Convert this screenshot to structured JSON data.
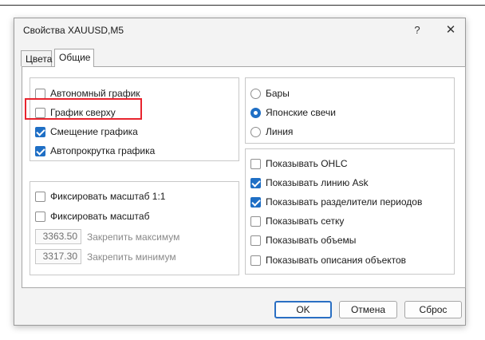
{
  "window": {
    "title": "Свойства XAUUSD,M5",
    "help_glyph": "?",
    "close_glyph": "✕"
  },
  "tabs": [
    {
      "label": "Цвета",
      "active": false
    },
    {
      "label": "Общие",
      "active": true
    }
  ],
  "left_top": [
    {
      "label": "Автономный график",
      "checked": false
    },
    {
      "label": "График сверху",
      "checked": false,
      "highlighted": true
    },
    {
      "label": "Смещение графика",
      "checked": true
    },
    {
      "label": "Автопрокрутка графика",
      "checked": true
    }
  ],
  "left_bottom": {
    "checks": [
      {
        "label": "Фиксировать масштаб 1:1",
        "checked": false
      },
      {
        "label": "Фиксировать масштаб",
        "checked": false
      }
    ],
    "fields": [
      {
        "value": "3363.50",
        "label": "Закрепить максимум"
      },
      {
        "value": "3317.30",
        "label": "Закрепить минимум"
      }
    ]
  },
  "chart_type": [
    {
      "label": "Бары",
      "selected": false
    },
    {
      "label": "Японские свечи",
      "selected": true
    },
    {
      "label": "Линия",
      "selected": false
    }
  ],
  "right_bottom": [
    {
      "label": "Показывать OHLC",
      "checked": false
    },
    {
      "label": "Показывать линию Ask",
      "checked": true
    },
    {
      "label": "Показывать разделители периодов",
      "checked": true
    },
    {
      "label": "Показывать сетку",
      "checked": false
    },
    {
      "label": "Показывать объемы",
      "checked": false
    },
    {
      "label": "Показывать описания объектов",
      "checked": false
    }
  ],
  "buttons": {
    "ok": "OK",
    "cancel": "Отмена",
    "reset": "Сброс"
  },
  "colors": {
    "accent": "#1f6fc5",
    "highlight": "#e8242e"
  }
}
